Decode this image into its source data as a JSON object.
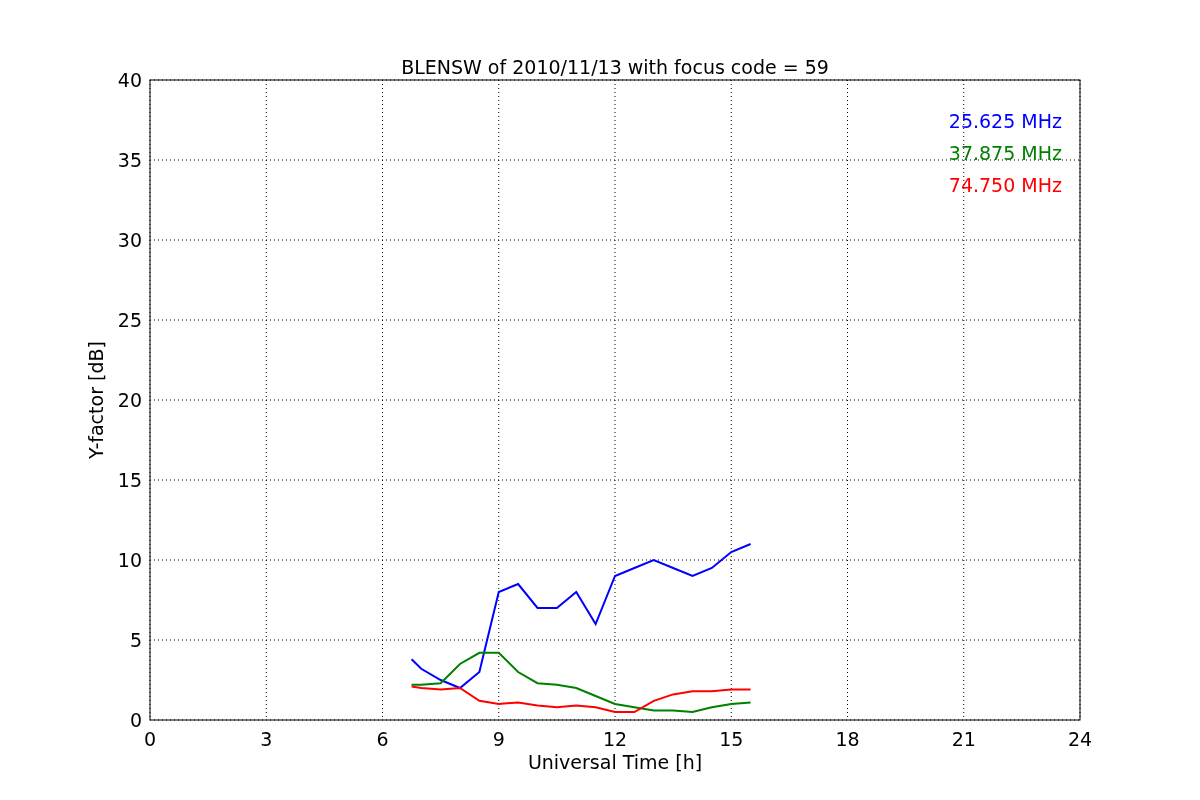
{
  "plot": {
    "chart_data": {
      "type": "line",
      "title": "BLENSW of 2010/11/13 with focus code = 59",
      "xlabel": "Universal Time [h]",
      "ylabel": "Y-factor [dB]",
      "x": [
        6.75,
        7,
        7.5,
        8,
        8.5,
        9,
        9.5,
        10,
        10.5,
        11,
        11.5,
        12,
        12.5,
        13,
        13.5,
        14,
        14.5,
        15,
        15.5
      ],
      "series": [
        {
          "name": "25.625 MHz",
          "color": "#0000ff",
          "values": [
            3.8,
            3.2,
            2.5,
            2.0,
            3.0,
            8.0,
            8.5,
            7.0,
            7.0,
            8.0,
            6.0,
            9.0,
            9.5,
            10.0,
            9.5,
            9.0,
            9.5,
            10.5,
            11.0
          ]
        },
        {
          "name": "37.875 MHz",
          "color": "#008000",
          "values": [
            2.2,
            2.2,
            2.3,
            3.5,
            4.2,
            4.2,
            3.0,
            2.3,
            2.2,
            2.0,
            1.5,
            1.0,
            0.8,
            0.6,
            0.6,
            0.5,
            0.8,
            1.0,
            1.1
          ]
        },
        {
          "name": "74.750 MHz",
          "color": "#ff0000",
          "values": [
            2.1,
            2.0,
            1.9,
            2.0,
            1.2,
            1.0,
            1.1,
            0.9,
            0.8,
            0.9,
            0.8,
            0.5,
            0.5,
            1.2,
            1.6,
            1.8,
            1.8,
            1.9,
            1.9
          ]
        }
      ],
      "xlim": [
        0,
        24
      ],
      "ylim": [
        0,
        40
      ],
      "xticks": [
        0,
        3,
        6,
        9,
        12,
        15,
        18,
        21,
        24
      ],
      "yticks": [
        0,
        5,
        10,
        15,
        20,
        25,
        30,
        35,
        40
      ],
      "grid": true
    }
  }
}
